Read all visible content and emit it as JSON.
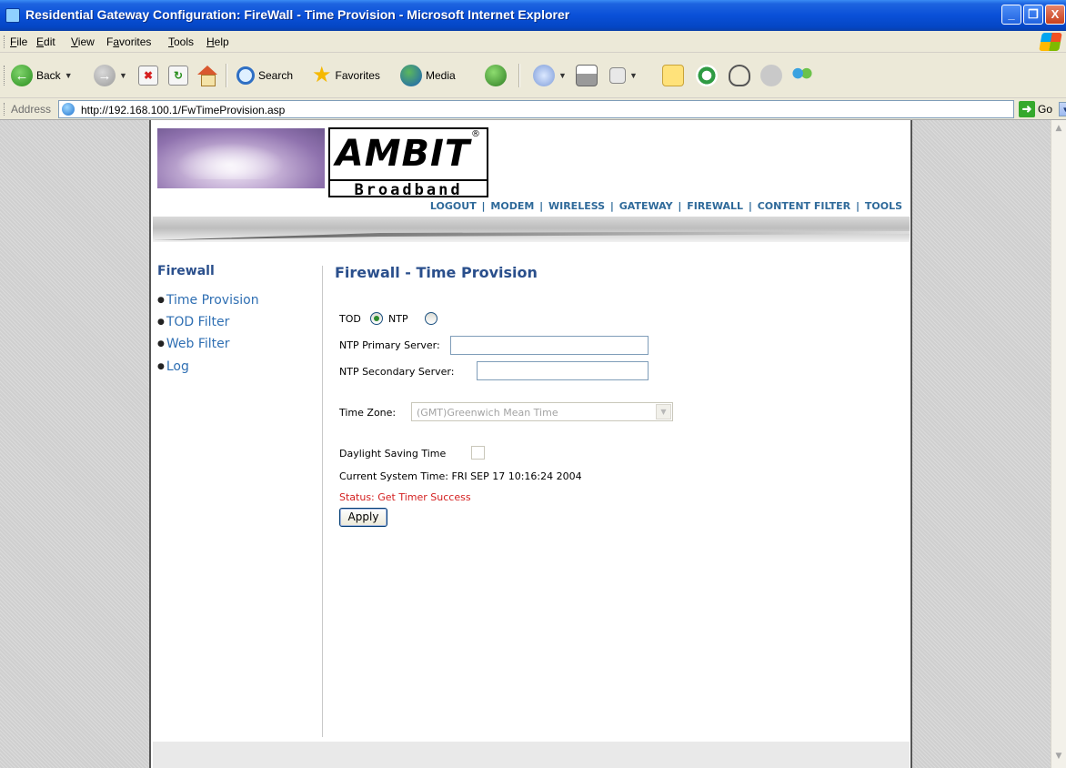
{
  "window": {
    "title": "Residential Gateway Configuration: FireWall - Time Provision - Microsoft Internet Explorer",
    "controls": {
      "minimize": "_",
      "maximize": "❐",
      "close": "X"
    }
  },
  "menubar": {
    "items": [
      {
        "label": "File",
        "u": "F",
        "rest": "ile"
      },
      {
        "label": "Edit",
        "u": "E",
        "rest": "dit"
      },
      {
        "label": "View",
        "u": "V",
        "rest": "iew"
      },
      {
        "label": "Favorites",
        "pre": "F",
        "u": "a",
        "rest": "vorites"
      },
      {
        "label": "Tools",
        "u": "T",
        "rest": "ools"
      },
      {
        "label": "Help",
        "u": "H",
        "rest": "elp"
      }
    ]
  },
  "toolbar": {
    "back_label": "Back",
    "search_label": "Search",
    "favorites_label": "Favorites",
    "media_label": "Media",
    "icons": [
      "back-icon",
      "forward-icon",
      "stop-icon",
      "refresh-icon",
      "home-icon",
      "search-icon",
      "favorites-star-icon",
      "media-icon",
      "history-icon",
      "mail-icon",
      "print-icon",
      "edit-icon",
      "discuss-icon",
      "messenger-icon",
      "research-icon",
      "contacts-icon"
    ]
  },
  "addressbar": {
    "label": "Address",
    "url": "http://192.168.100.1/FwTimeProvision.asp",
    "go_label": "Go"
  },
  "brand": {
    "name": "AMBIT",
    "registered": "®",
    "tagline": "Broadband"
  },
  "topnav": [
    {
      "label": "LOGOUT"
    },
    {
      "label": "MODEM"
    },
    {
      "label": "WIRELESS"
    },
    {
      "label": "GATEWAY"
    },
    {
      "label": "FIREWALL"
    },
    {
      "label": "CONTENT FILTER"
    },
    {
      "label": "TOOLS"
    }
  ],
  "sidebar": {
    "title": "Firewall",
    "items": [
      {
        "label": "Time Provision"
      },
      {
        "label": "TOD Filter"
      },
      {
        "label": "Web Filter"
      },
      {
        "label": "Log"
      }
    ]
  },
  "main": {
    "title": "Firewall - Time Provision",
    "mode": {
      "tod_label": "TOD",
      "ntp_label": "NTP",
      "selected": "TOD"
    },
    "ntp_primary_label": "NTP Primary Server:",
    "ntp_primary_value": "",
    "ntp_secondary_label": "NTP Secondary Server:",
    "ntp_secondary_value": "",
    "timezone_label": "Time Zone:",
    "timezone_value": "(GMT)Greenwich Mean Time",
    "dst_label": "Daylight Saving Time",
    "dst_checked": false,
    "current_time_text": "Current System Time: FRI SEP 17 10:16:24 2004",
    "status_text": "Status: Get Timer Success",
    "apply_label": "Apply"
  },
  "colors": {
    "title_bar": "#0a50d8",
    "link_blue": "#2f6fb3",
    "heading_blue": "#2a4f8c",
    "status_red": "#d41f1f"
  }
}
